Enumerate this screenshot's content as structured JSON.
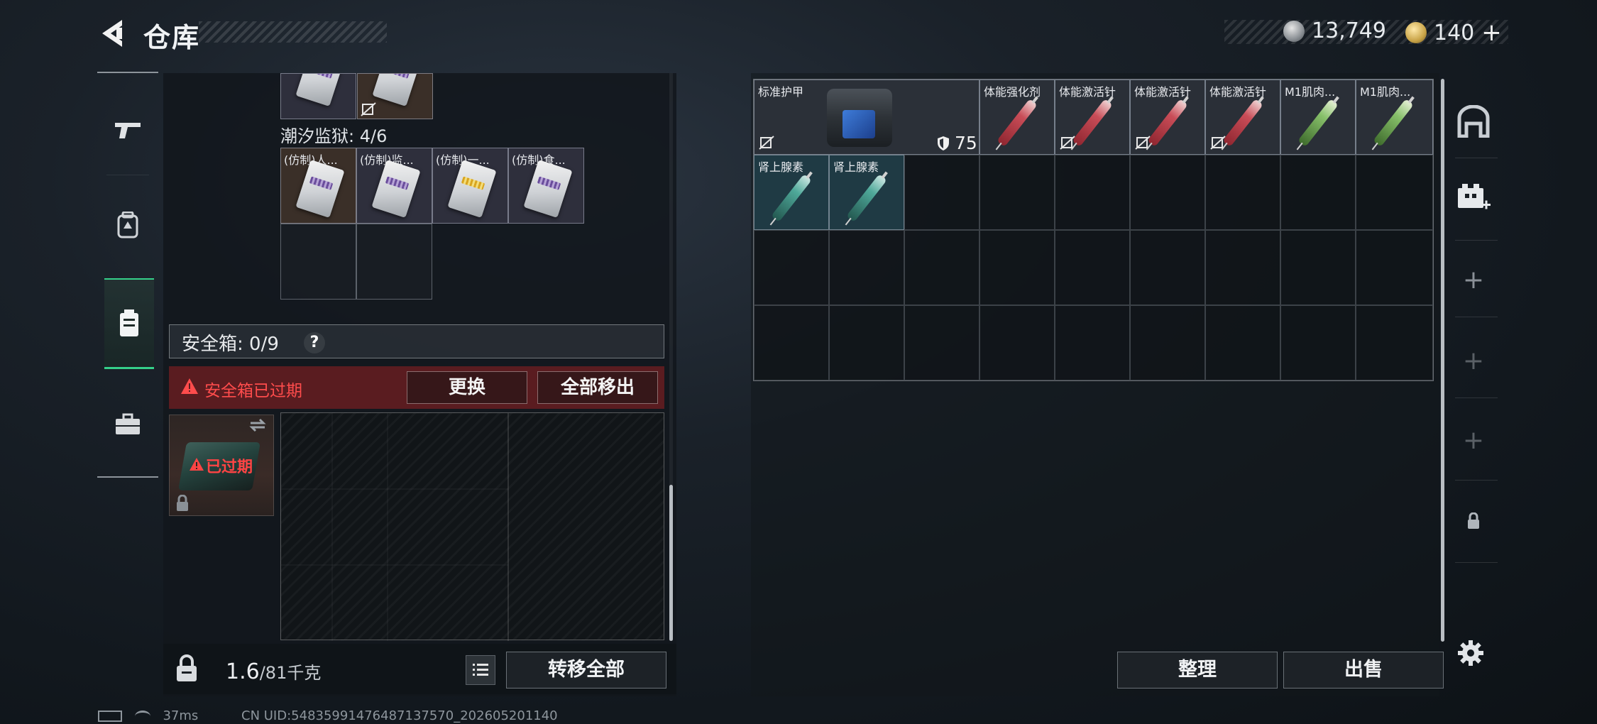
{
  "header": {
    "title": "仓库",
    "silver_amount": "13,749",
    "gold_amount": "140",
    "add_label": "+"
  },
  "left_nav": {
    "items": [
      "weapon-icon",
      "backpack-icon",
      "safebox-icon",
      "briefcase-icon"
    ],
    "active_index": 2
  },
  "left_panel": {
    "prison_label": "潮汐监狱: 4/6",
    "prison_items": [
      {
        "name": "(仿制)人...",
        "bg": "#3a2f28"
      },
      {
        "name": "(仿制)监...",
        "bg": "#2e2f3c"
      },
      {
        "name": "(仿制)一...",
        "bg": "#2e2f3c"
      },
      {
        "name": "(仿制)食...",
        "bg": "#2e2f3c"
      }
    ],
    "safebox_label": "安全箱: 0/9",
    "help": "?",
    "expired_notice": "安全箱已过期",
    "replace_button": "更换",
    "remove_all_button": "全部移出",
    "thumb_expired": "已过期",
    "weight_current": "1.6",
    "weight_max": "/81千克",
    "transfer_all_button": "转移全部"
  },
  "right_panel": {
    "items": [
      {
        "name": "标准护甲",
        "type": "armor",
        "durability": "75"
      },
      {
        "name": "体能强化剂",
        "type": "red"
      },
      {
        "name": "体能激活针",
        "type": "red"
      },
      {
        "name": "体能激活针",
        "type": "red"
      },
      {
        "name": "体能激活针",
        "type": "red"
      },
      {
        "name": "M1肌肉...",
        "type": "green"
      },
      {
        "name": "M1肌肉...",
        "type": "green"
      },
      {
        "name": "肾上腺素",
        "type": "teal"
      },
      {
        "name": "肾上腺素",
        "type": "teal"
      }
    ],
    "sort_button": "整理",
    "sell_button": "出售"
  },
  "right_side": {
    "plus": "+"
  },
  "status_bar": {
    "ping": "37ms",
    "uid": "CN UID:5483599147648713757​0_202605201140"
  },
  "colors": {
    "accent_green": "#35d08a",
    "warning_red": "#ff4c4c",
    "expired_bg": "#5a1c20"
  }
}
